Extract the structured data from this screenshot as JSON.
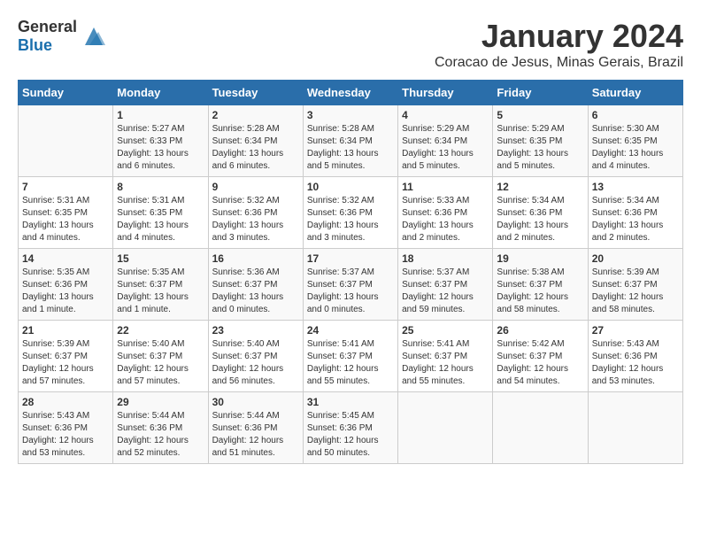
{
  "header": {
    "logo_general": "General",
    "logo_blue": "Blue",
    "month_title": "January 2024",
    "location": "Coracao de Jesus, Minas Gerais, Brazil"
  },
  "weekdays": [
    "Sunday",
    "Monday",
    "Tuesday",
    "Wednesday",
    "Thursday",
    "Friday",
    "Saturday"
  ],
  "weeks": [
    [
      {
        "day": "",
        "sunrise": "",
        "sunset": "",
        "daylight": ""
      },
      {
        "day": "1",
        "sunrise": "Sunrise: 5:27 AM",
        "sunset": "Sunset: 6:33 PM",
        "daylight": "Daylight: 13 hours and 6 minutes."
      },
      {
        "day": "2",
        "sunrise": "Sunrise: 5:28 AM",
        "sunset": "Sunset: 6:34 PM",
        "daylight": "Daylight: 13 hours and 6 minutes."
      },
      {
        "day": "3",
        "sunrise": "Sunrise: 5:28 AM",
        "sunset": "Sunset: 6:34 PM",
        "daylight": "Daylight: 13 hours and 5 minutes."
      },
      {
        "day": "4",
        "sunrise": "Sunrise: 5:29 AM",
        "sunset": "Sunset: 6:34 PM",
        "daylight": "Daylight: 13 hours and 5 minutes."
      },
      {
        "day": "5",
        "sunrise": "Sunrise: 5:29 AM",
        "sunset": "Sunset: 6:35 PM",
        "daylight": "Daylight: 13 hours and 5 minutes."
      },
      {
        "day": "6",
        "sunrise": "Sunrise: 5:30 AM",
        "sunset": "Sunset: 6:35 PM",
        "daylight": "Daylight: 13 hours and 4 minutes."
      }
    ],
    [
      {
        "day": "7",
        "sunrise": "Sunrise: 5:31 AM",
        "sunset": "Sunset: 6:35 PM",
        "daylight": "Daylight: 13 hours and 4 minutes."
      },
      {
        "day": "8",
        "sunrise": "Sunrise: 5:31 AM",
        "sunset": "Sunset: 6:35 PM",
        "daylight": "Daylight: 13 hours and 4 minutes."
      },
      {
        "day": "9",
        "sunrise": "Sunrise: 5:32 AM",
        "sunset": "Sunset: 6:36 PM",
        "daylight": "Daylight: 13 hours and 3 minutes."
      },
      {
        "day": "10",
        "sunrise": "Sunrise: 5:32 AM",
        "sunset": "Sunset: 6:36 PM",
        "daylight": "Daylight: 13 hours and 3 minutes."
      },
      {
        "day": "11",
        "sunrise": "Sunrise: 5:33 AM",
        "sunset": "Sunset: 6:36 PM",
        "daylight": "Daylight: 13 hours and 2 minutes."
      },
      {
        "day": "12",
        "sunrise": "Sunrise: 5:34 AM",
        "sunset": "Sunset: 6:36 PM",
        "daylight": "Daylight: 13 hours and 2 minutes."
      },
      {
        "day": "13",
        "sunrise": "Sunrise: 5:34 AM",
        "sunset": "Sunset: 6:36 PM",
        "daylight": "Daylight: 13 hours and 2 minutes."
      }
    ],
    [
      {
        "day": "14",
        "sunrise": "Sunrise: 5:35 AM",
        "sunset": "Sunset: 6:36 PM",
        "daylight": "Daylight: 13 hours and 1 minute."
      },
      {
        "day": "15",
        "sunrise": "Sunrise: 5:35 AM",
        "sunset": "Sunset: 6:37 PM",
        "daylight": "Daylight: 13 hours and 1 minute."
      },
      {
        "day": "16",
        "sunrise": "Sunrise: 5:36 AM",
        "sunset": "Sunset: 6:37 PM",
        "daylight": "Daylight: 13 hours and 0 minutes."
      },
      {
        "day": "17",
        "sunrise": "Sunrise: 5:37 AM",
        "sunset": "Sunset: 6:37 PM",
        "daylight": "Daylight: 13 hours and 0 minutes."
      },
      {
        "day": "18",
        "sunrise": "Sunrise: 5:37 AM",
        "sunset": "Sunset: 6:37 PM",
        "daylight": "Daylight: 12 hours and 59 minutes."
      },
      {
        "day": "19",
        "sunrise": "Sunrise: 5:38 AM",
        "sunset": "Sunset: 6:37 PM",
        "daylight": "Daylight: 12 hours and 58 minutes."
      },
      {
        "day": "20",
        "sunrise": "Sunrise: 5:39 AM",
        "sunset": "Sunset: 6:37 PM",
        "daylight": "Daylight: 12 hours and 58 minutes."
      }
    ],
    [
      {
        "day": "21",
        "sunrise": "Sunrise: 5:39 AM",
        "sunset": "Sunset: 6:37 PM",
        "daylight": "Daylight: 12 hours and 57 minutes."
      },
      {
        "day": "22",
        "sunrise": "Sunrise: 5:40 AM",
        "sunset": "Sunset: 6:37 PM",
        "daylight": "Daylight: 12 hours and 57 minutes."
      },
      {
        "day": "23",
        "sunrise": "Sunrise: 5:40 AM",
        "sunset": "Sunset: 6:37 PM",
        "daylight": "Daylight: 12 hours and 56 minutes."
      },
      {
        "day": "24",
        "sunrise": "Sunrise: 5:41 AM",
        "sunset": "Sunset: 6:37 PM",
        "daylight": "Daylight: 12 hours and 55 minutes."
      },
      {
        "day": "25",
        "sunrise": "Sunrise: 5:41 AM",
        "sunset": "Sunset: 6:37 PM",
        "daylight": "Daylight: 12 hours and 55 minutes."
      },
      {
        "day": "26",
        "sunrise": "Sunrise: 5:42 AM",
        "sunset": "Sunset: 6:37 PM",
        "daylight": "Daylight: 12 hours and 54 minutes."
      },
      {
        "day": "27",
        "sunrise": "Sunrise: 5:43 AM",
        "sunset": "Sunset: 6:36 PM",
        "daylight": "Daylight: 12 hours and 53 minutes."
      }
    ],
    [
      {
        "day": "28",
        "sunrise": "Sunrise: 5:43 AM",
        "sunset": "Sunset: 6:36 PM",
        "daylight": "Daylight: 12 hours and 53 minutes."
      },
      {
        "day": "29",
        "sunrise": "Sunrise: 5:44 AM",
        "sunset": "Sunset: 6:36 PM",
        "daylight": "Daylight: 12 hours and 52 minutes."
      },
      {
        "day": "30",
        "sunrise": "Sunrise: 5:44 AM",
        "sunset": "Sunset: 6:36 PM",
        "daylight": "Daylight: 12 hours and 51 minutes."
      },
      {
        "day": "31",
        "sunrise": "Sunrise: 5:45 AM",
        "sunset": "Sunset: 6:36 PM",
        "daylight": "Daylight: 12 hours and 50 minutes."
      },
      {
        "day": "",
        "sunrise": "",
        "sunset": "",
        "daylight": ""
      },
      {
        "day": "",
        "sunrise": "",
        "sunset": "",
        "daylight": ""
      },
      {
        "day": "",
        "sunrise": "",
        "sunset": "",
        "daylight": ""
      }
    ]
  ]
}
